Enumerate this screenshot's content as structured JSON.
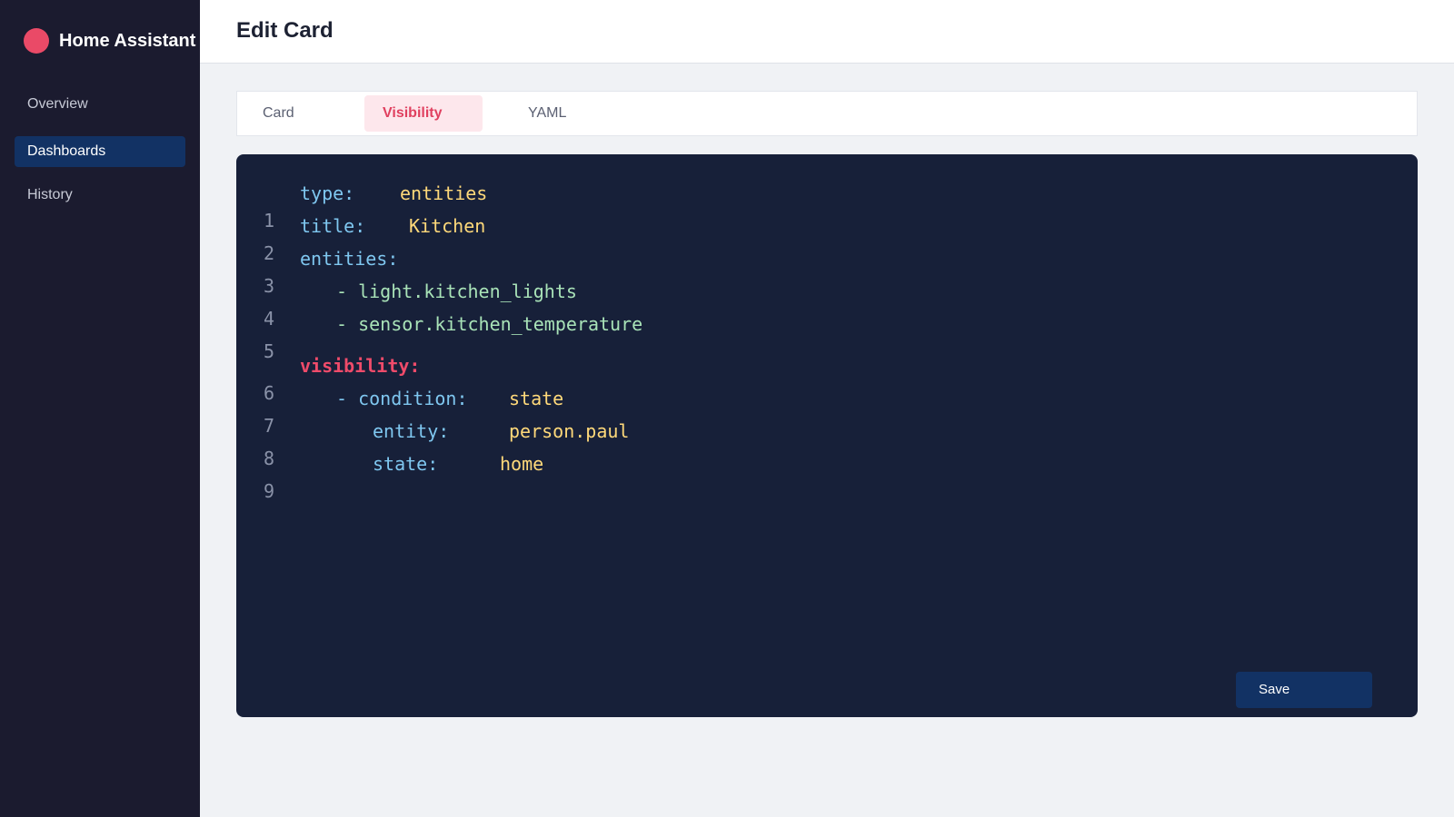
{
  "app": {
    "name": "Home Assistant",
    "accent": "#ea4a67"
  },
  "sidebar": {
    "items": [
      {
        "label": "Overview",
        "active": false
      },
      {
        "label": "Dashboards",
        "active": true
      },
      {
        "label": "History",
        "active": false
      }
    ]
  },
  "header": {
    "title": "Edit Card"
  },
  "tabs": [
    {
      "label": "Card",
      "active": false
    },
    {
      "label": "Visibility",
      "active": true
    },
    {
      "label": "YAML",
      "active": false
    }
  ],
  "editor": {
    "lines": [
      {
        "num": "1",
        "key": "type:",
        "value": "entities"
      },
      {
        "num": "2",
        "key": "title:",
        "value": "Kitchen"
      },
      {
        "num": "3",
        "key": "entities:"
      },
      {
        "num": "4",
        "item": "- light.kitchen_lights"
      },
      {
        "num": "5",
        "item": "- sensor.kitchen_temperature"
      },
      {
        "num": "6",
        "key": "visibility:"
      },
      {
        "num": "7",
        "key": "- condition:",
        "value": "state"
      },
      {
        "num": "8",
        "key": "entity:",
        "value": "person.paul"
      },
      {
        "num": "9",
        "key": "state:",
        "value": "home"
      }
    ],
    "save_label": "Save"
  }
}
